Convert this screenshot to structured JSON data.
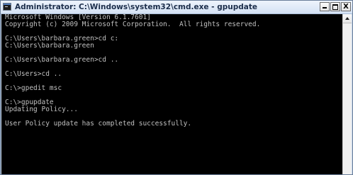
{
  "window": {
    "title": "Administrator: C:\\Windows\\system32\\cmd.exe - gpupdate",
    "close_label": "X",
    "app_icon": "cmd-icon"
  },
  "console": {
    "lines": [
      "Microsoft Windows [Version 6.1.7601]",
      "Copyright (c) 2009 Microsoft Corporation.  All rights reserved.",
      "",
      "C:\\Users\\barbara.green>cd c:",
      "C:\\Users\\barbara.green",
      "",
      "C:\\Users\\barbara.green>cd ..",
      "",
      "C:\\Users>cd ..",
      "",
      "C:\\>gpedit msc",
      "",
      "C:\\>gpupdate",
      "Updating Policy...",
      "",
      "User Policy update has completed successfully."
    ]
  },
  "colors": {
    "console_background": "#000000",
    "console_text": "#c0c0c0",
    "title_bar": "#d4e2f4"
  }
}
